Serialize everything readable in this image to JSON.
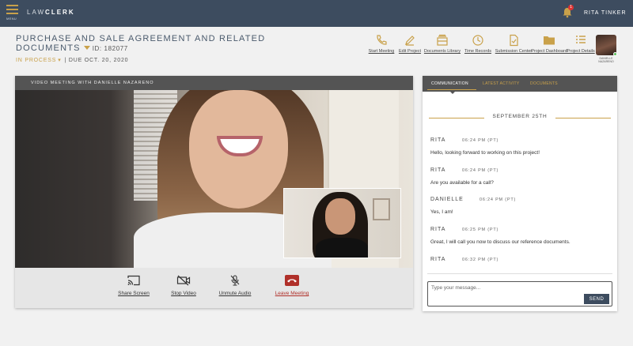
{
  "app": {
    "menu_label": "MENU",
    "logo_light": "LAW",
    "logo_bold": "CLERK"
  },
  "header": {
    "notification_count": "1",
    "user_name": "RITA TINKER"
  },
  "project": {
    "title": "PURCHASE AND SALE AGREEMENT AND RELATED DOCUMENTS",
    "id_label": "ID: 182077",
    "status": "IN PROCESS",
    "due": "| DUE OCT. 20, 2020"
  },
  "toolbar": [
    {
      "icon": "phone-icon",
      "label": "Start Meeting"
    },
    {
      "icon": "pencil-icon",
      "label": "Edit Project"
    },
    {
      "icon": "library-icon",
      "label": "Documents Library"
    },
    {
      "icon": "clock-icon",
      "label": "Time Records"
    },
    {
      "icon": "submission-icon",
      "label": "Submission Center"
    },
    {
      "icon": "folder-icon",
      "label": "Project Dashboard"
    },
    {
      "icon": "list-icon",
      "label": "Project Details"
    }
  ],
  "profile": {
    "name": "DANIELLE NAZARENO"
  },
  "video": {
    "header": "VIDEO MEETING WITH DANIELLE NAZARENO",
    "controls": [
      {
        "icon": "cast-icon",
        "label": "Share Screen"
      },
      {
        "icon": "video-off-icon",
        "label": "Stop Video"
      },
      {
        "icon": "mic-icon",
        "label": "Unmute Audio"
      },
      {
        "icon": "hangup-icon",
        "label": "Leave Meeting"
      }
    ]
  },
  "chat": {
    "tabs": [
      "COMMUNICATION",
      "LATEST ACTIVITY",
      "DOCUMENTS"
    ],
    "date": "SEPTEMBER 25TH",
    "messages": [
      {
        "sender": "RITA",
        "time": "06:24 PM (PT)",
        "text": "Hello, looking forward to working on this project!"
      },
      {
        "sender": "RITA",
        "time": "06:24 PM (PT)",
        "text": "Are you available for a call?"
      },
      {
        "sender": "DANIELLE",
        "time": "06:24 PM (PT)",
        "text": "Yes, I am!"
      },
      {
        "sender": "RITA",
        "time": "06:25 PM (PT)",
        "text": "Great, I will call you now to discuss our reference documents."
      },
      {
        "sender": "RITA",
        "time": "06:32 PM (PT)",
        "text": ""
      }
    ],
    "placeholder": "Type your message...",
    "send_label": "SEND"
  },
  "colors": {
    "topbar": "#3d4c5f",
    "accent": "#c9a14a",
    "leave": "#b0302a"
  }
}
